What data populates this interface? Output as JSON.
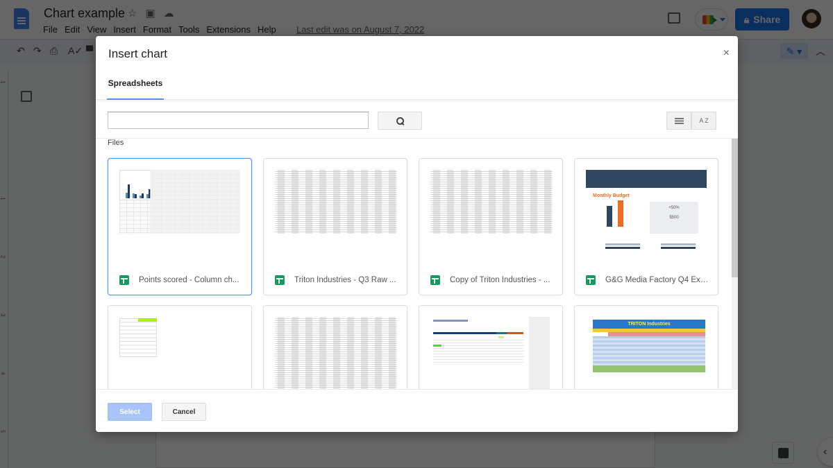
{
  "app": {
    "doc_title": "Chart example",
    "menu": [
      "File",
      "Edit",
      "View",
      "Insert",
      "Format",
      "Tools",
      "Extensions",
      "Help"
    ],
    "last_edit": "Last edit was on August 7, 2022",
    "share_label": "Share",
    "toolbar_icons": [
      "undo-icon",
      "redo-icon",
      "print-icon",
      "spellcheck-icon",
      "paint-format-icon"
    ],
    "ruler_numbers": [
      "1",
      "1",
      "2",
      "3",
      "4",
      "5"
    ]
  },
  "dialog": {
    "title": "Insert chart",
    "close_glyph": "×",
    "tabs": [
      {
        "label": "Spreadsheets",
        "active": true
      }
    ],
    "search": {
      "value": "",
      "placeholder": ""
    },
    "view_sort_label": "A Z",
    "files_label": "Files",
    "files": [
      {
        "name": "Points scored - Column ch...",
        "selected": true,
        "thumb": "chart"
      },
      {
        "name": "Triton Industries - Q3 Raw ...",
        "selected": false,
        "thumb": "table"
      },
      {
        "name": "Copy of Triton Industries - ...",
        "selected": false,
        "thumb": "table"
      },
      {
        "name": "G&G Media Factory Q4 Exp...",
        "selected": false,
        "thumb": "budget"
      },
      {
        "name": "",
        "selected": false,
        "thumb": "list"
      },
      {
        "name": "",
        "selected": false,
        "thumb": "table"
      },
      {
        "name": "",
        "selected": false,
        "thumb": "tracking"
      },
      {
        "name": "",
        "selected": false,
        "thumb": "triton"
      }
    ],
    "thumb_text": {
      "budget_heading": "Monthly Budget",
      "budget_pct": "+50%",
      "budget_amount": "$500",
      "triton_heading": "TRITON Industries"
    },
    "select_label": "Select",
    "cancel_label": "Cancel"
  }
}
